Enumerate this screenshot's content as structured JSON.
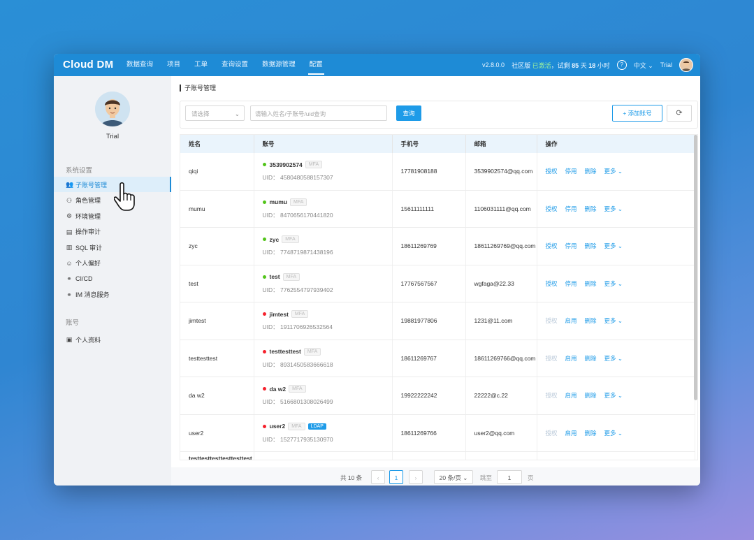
{
  "app": {
    "logo": "Cloud DM"
  },
  "nav": [
    "数据查询",
    "项目",
    "工单",
    "查询设置",
    "数据源管理",
    "配置"
  ],
  "nav_active": 5,
  "header_right": {
    "version": "v2.8.0.0",
    "edition_prefix": "社区版",
    "edition_highlight": "已激活",
    "trial_text": "试剩",
    "days_num": "85",
    "days_unit": "天",
    "hours_num": "18",
    "hours_unit": "小时",
    "help": "?",
    "language": "中文",
    "user": "Trial"
  },
  "sidebar": {
    "user": "Trial",
    "group1_title": "系统设置",
    "group1": [
      {
        "icon": "users-icon",
        "glyph": "👥",
        "label": "子账号管理"
      },
      {
        "icon": "role-icon",
        "glyph": "⚇",
        "label": "角色管理"
      },
      {
        "icon": "env-icon",
        "glyph": "⚙",
        "label": "环境管理"
      },
      {
        "icon": "audit-icon",
        "glyph": "▤",
        "label": "操作审计"
      },
      {
        "icon": "sql-audit-icon",
        "glyph": "▥",
        "label": "SQL 审计"
      },
      {
        "icon": "preference-icon",
        "glyph": "☺",
        "label": "个人偏好"
      },
      {
        "icon": "cicd-icon",
        "glyph": "⚭",
        "label": "CI/CD"
      },
      {
        "icon": "im-icon",
        "glyph": "⚭",
        "label": "IM 消息服务"
      }
    ],
    "group2_title": "账号",
    "group2": [
      {
        "icon": "profile-icon",
        "glyph": "▣",
        "label": "个人资料"
      }
    ]
  },
  "main": {
    "title": "子账号管理",
    "select_placeholder": "请选择",
    "search_placeholder": "请输入姓名/子账号/uid查询",
    "search_button": "查询",
    "add_button": "+ 添加账号",
    "refresh": "⟳"
  },
  "table": {
    "headers": [
      "姓名",
      "账号",
      "手机号",
      "邮箱",
      "操作"
    ],
    "rows": [
      {
        "name": "qiqi",
        "account": "3539902574",
        "status": "green",
        "mfa": "MFA",
        "uid": "UID：  4580480588157307",
        "phone": "17781908188",
        "email": "3539902574@qq.com",
        "ops": [
          "授权",
          "停用",
          "删除",
          "更多 ⌄"
        ],
        "enabled": true
      },
      {
        "name": "mumu",
        "account": "mumu",
        "status": "green",
        "mfa": "MFA",
        "uid": "UID：  8470656170441820",
        "phone": "15611111111",
        "email": "1106031111@qq.com",
        "ops": [
          "授权",
          "停用",
          "删除",
          "更多 ⌄"
        ],
        "enabled": true
      },
      {
        "name": "zyc",
        "account": "zyc",
        "status": "green",
        "mfa": "MFA",
        "uid": "UID：  7748719871438196",
        "phone": "18611269769",
        "email": "18611269769@qq.com",
        "ops": [
          "授权",
          "停用",
          "删除",
          "更多 ⌄"
        ],
        "enabled": true
      },
      {
        "name": "test",
        "account": "test",
        "status": "green",
        "mfa": "MFA",
        "uid": "UID：  7762554797939402",
        "phone": "17767567567",
        "email": "wgfaga@22.33",
        "ops": [
          "授权",
          "停用",
          "删除",
          "更多 ⌄"
        ],
        "enabled": true
      },
      {
        "name": "jimtest",
        "account": "jimtest",
        "status": "red",
        "mfa": "MFA",
        "uid": "UID：  1911706926532564",
        "phone": "19881977806",
        "email": "1231@11.com",
        "ops": [
          "授权",
          "启用",
          "删除",
          "更多 ⌄"
        ],
        "enabled": false
      },
      {
        "name": "testtesttest",
        "account": "testtesttest",
        "status": "red",
        "mfa": "MFA",
        "uid": "UID：  8931450583666618",
        "phone": "18611269767",
        "email": "18611269766@qq.com",
        "ops": [
          "授权",
          "启用",
          "删除",
          "更多 ⌄"
        ],
        "enabled": false
      },
      {
        "name": "da w2",
        "account": "da w2",
        "status": "red",
        "mfa": "MFA",
        "uid": "UID：  5166801308026499",
        "phone": "19922222242",
        "email": "22222@c.22",
        "ops": [
          "授权",
          "启用",
          "删除",
          "更多 ⌄"
        ],
        "enabled": false
      },
      {
        "name": "user2",
        "account": "user2",
        "status": "red",
        "mfa": "MFA",
        "ldap": "LDAP",
        "uid": "UID：  1527717935130970",
        "phone": "18611269766",
        "email": "user2@qq.com",
        "ops": [
          "授权",
          "启用",
          "删除",
          "更多 ⌄"
        ],
        "enabled": false
      },
      {
        "name": "testtesttesttesttesttesttesttesttesttest",
        "account": "",
        "status": "",
        "mfa": "",
        "uid": "",
        "phone": "",
        "email": "",
        "ops": [],
        "enabled": false
      }
    ]
  },
  "pager": {
    "total": "共 10 条",
    "prev": "‹",
    "page": "1",
    "next": "›",
    "size": "20 条/页 ⌄",
    "goto_label": "跳至",
    "goto_value": "1",
    "goto_unit": "页"
  }
}
